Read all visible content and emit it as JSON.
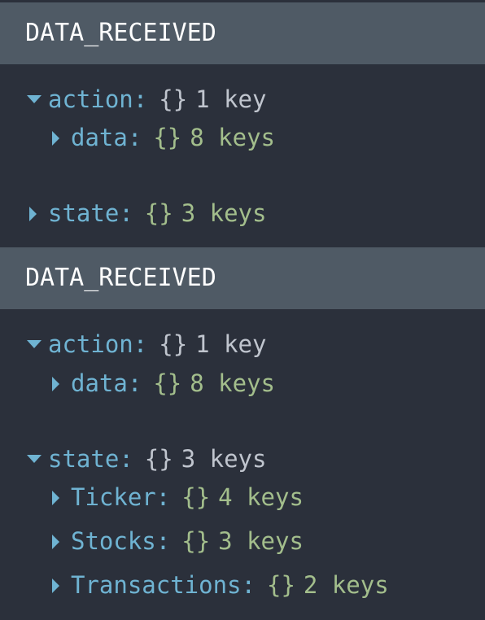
{
  "entries": [
    {
      "header": "DATA_RECEIVED",
      "action": {
        "key": "action",
        "type": "{}",
        "summary": "1 key",
        "expanded": true
      },
      "action_data": {
        "key": "data",
        "type": "{}",
        "summary": "8 keys",
        "expanded": false
      },
      "state": {
        "key": "state",
        "type": "{}",
        "summary": "3 keys",
        "expanded": false
      }
    },
    {
      "header": "DATA_RECEIVED",
      "action": {
        "key": "action",
        "type": "{}",
        "summary": "1 key",
        "expanded": true
      },
      "action_data": {
        "key": "data",
        "type": "{}",
        "summary": "8 keys",
        "expanded": false
      },
      "state": {
        "key": "state",
        "type": "{}",
        "summary": "3 keys",
        "expanded": true
      },
      "state_children": [
        {
          "key": "Ticker",
          "type": "{}",
          "summary": "4 keys",
          "expanded": false
        },
        {
          "key": "Stocks",
          "type": "{}",
          "summary": "3 keys",
          "expanded": false
        },
        {
          "key": "Transactions",
          "type": "{}",
          "summary": "2 keys",
          "expanded": false
        }
      ]
    }
  ],
  "colors": {
    "background": "#2b303b",
    "header_bg": "#4f5a65",
    "key": "#6fb3d2",
    "expanded_value": "#c0c5ce",
    "collapsed_value": "#a3be8c"
  },
  "icons": {
    "expanded": "caret-down-icon",
    "collapsed": "caret-right-icon"
  }
}
